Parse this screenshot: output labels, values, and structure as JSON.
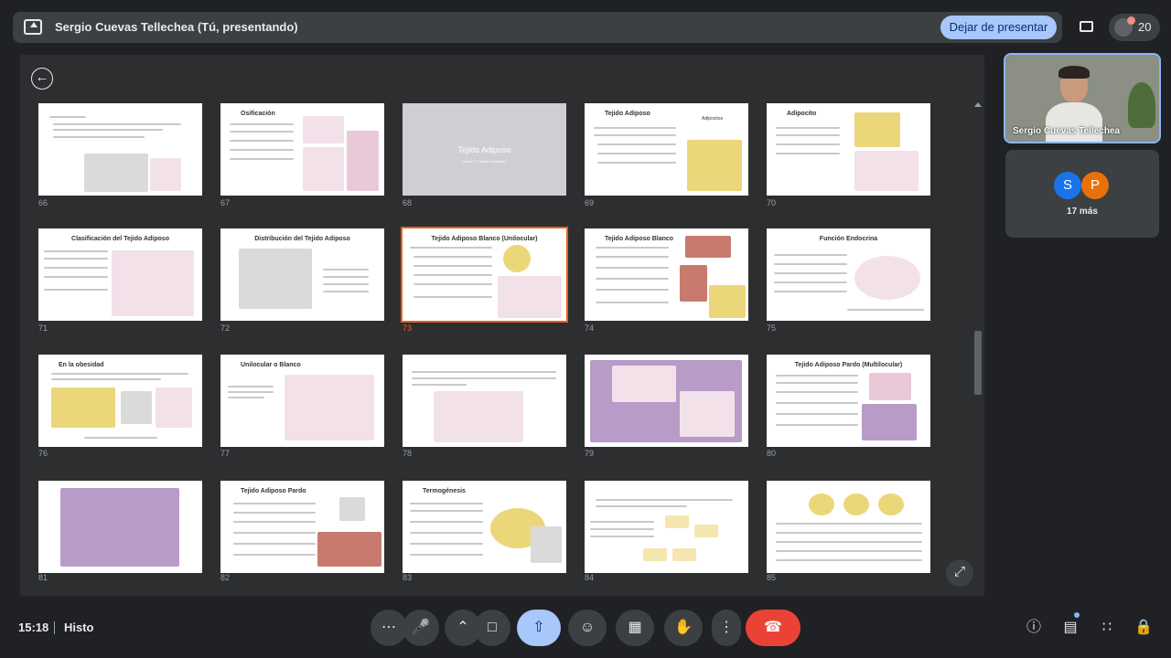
{
  "topbar": {
    "title": "Sergio Cuevas Tellechea (Tú, presentando)",
    "stop_label": "Dejar de presentar",
    "participant_count": "20"
  },
  "grid": {
    "back_icon": "arrow-left-icon",
    "slides": [
      {
        "num": "66",
        "title": ""
      },
      {
        "num": "67",
        "title": "Osificación"
      },
      {
        "num": "68",
        "title": "Tejido Adiposo",
        "sub": "Unidad 3 \"Tejido Conjuntivo\""
      },
      {
        "num": "69",
        "title": "Tejido Adiposo",
        "caption": "Adipocitos"
      },
      {
        "num": "70",
        "title": "Adipocito"
      },
      {
        "num": "71",
        "title": "Clasificación del Tejido Adiposo"
      },
      {
        "num": "72",
        "title": "Distribución del Tejido Adiposo"
      },
      {
        "num": "73",
        "title": "Tejido Adiposo Blanco (Unilocular)"
      },
      {
        "num": "74",
        "title": "Tejido Adiposo Blanco"
      },
      {
        "num": "75",
        "title": "Función Endocrina"
      },
      {
        "num": "76",
        "title": "En la obesidad"
      },
      {
        "num": "77",
        "title": "Unilocular o Blanco"
      },
      {
        "num": "78",
        "title": ""
      },
      {
        "num": "79",
        "title": ""
      },
      {
        "num": "80",
        "title": "Tejido Adiposo Pardo (Multilocular)"
      },
      {
        "num": "81",
        "title": ""
      },
      {
        "num": "82",
        "title": "Tejido Adiposo Pardo"
      },
      {
        "num": "83",
        "title": "Termogénesis"
      },
      {
        "num": "84",
        "title": ""
      },
      {
        "num": "85",
        "title": ""
      }
    ]
  },
  "participants": {
    "self_name": "Sergio Cuevas Tellechea",
    "avatar_s": "S",
    "avatar_p": "P",
    "others_label": "17 más"
  },
  "bottom": {
    "time": "15:18",
    "meeting": "Histo"
  },
  "colors": {
    "accent": "#a8c7fa",
    "selected": "#e8601c",
    "end_call": "#ea4335"
  }
}
